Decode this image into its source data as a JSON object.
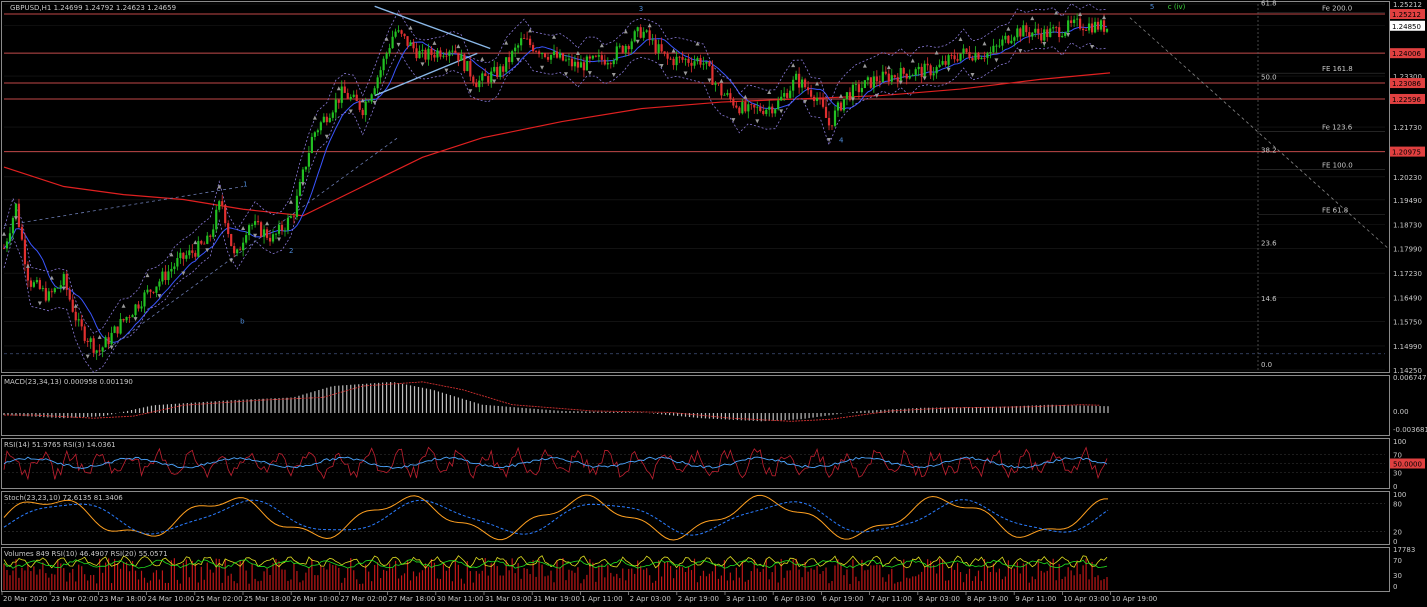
{
  "chart_data": {
    "type": "line",
    "symbol_title": "GBPUSD,H1  1.24699 1.24792 1.24623 1.24659",
    "main": {
      "ylim": [
        1.1425,
        1.2552
      ],
      "y_ticks": [
        1.2552,
        1.2485,
        1.24,
        1.233,
        1.226,
        1.2173,
        1.2097,
        1.202,
        1.1949,
        1.1873,
        1.1799,
        1.1723,
        1.1649,
        1.1575,
        1.1499,
        1.1425
      ],
      "y_tick_labels": [
        "1.25212",
        "1.24850",
        "1.24006",
        "1.23300",
        "1.22596",
        "1.21730",
        "1.20975",
        "1.20230",
        "1.19490",
        "1.18730",
        "1.17990",
        "1.17230",
        "1.16490",
        "1.15750",
        "1.14990",
        "1.14250"
      ],
      "highlight_tags": [
        {
          "text": "1.25212",
          "value": 1.25212,
          "color": "#e04040",
          "fg": "#000000"
        },
        {
          "text": "1.24850",
          "value": 1.2485,
          "color": "#ffffff",
          "fg": "#000000"
        },
        {
          "text": "1.24006",
          "value": 1.24006,
          "color": "#e04040",
          "fg": "#000000"
        },
        {
          "text": "1.23086",
          "value": 1.23086,
          "color": "#e04040",
          "fg": "#000000"
        },
        {
          "text": "1.22596",
          "value": 1.22596,
          "color": "#e04040",
          "fg": "#000000"
        },
        {
          "text": "1.20975",
          "value": 1.20975,
          "color": "#e04040",
          "fg": "#000000"
        }
      ],
      "horizontal_levels": [
        1.25212,
        1.24006,
        1.23086,
        1.22596,
        1.20975
      ],
      "fib_labels": [
        {
          "text": "Fe 200.0",
          "value": 1.2532
        },
        {
          "text": "FE 161.8",
          "value": 1.2345
        },
        {
          "text": "Fe 123.6",
          "value": 1.2165
        },
        {
          "text": "FE 100.0",
          "value": 1.2048
        },
        {
          "text": "FE 61.8",
          "value": 1.191
        }
      ],
      "retrace_labels": [
        {
          "text": "61.8",
          "value": 1.2548
        },
        {
          "text": "50.0",
          "value": 1.232
        },
        {
          "text": "38.2",
          "value": 1.2095
        },
        {
          "text": "23.6",
          "value": 1.1808
        },
        {
          "text": "14.6",
          "value": 1.1638
        },
        {
          "text": "0.0",
          "value": 1.1435
        }
      ],
      "wave_labels": [
        {
          "text": "1",
          "index": 240,
          "value": 1.199
        },
        {
          "text": "b",
          "index": 237,
          "value": 1.1568
        },
        {
          "text": "2",
          "index": 286,
          "value": 1.1785
        },
        {
          "text": "3",
          "index": 637,
          "value": 1.253
        },
        {
          "text": "4",
          "index": 838,
          "value": 1.2125
        },
        {
          "text": "5",
          "index": 1150,
          "value": 1.2537
        },
        {
          "text": "c (iv)",
          "index": 1168,
          "value": 1.2537
        }
      ]
    },
    "x_tick_labels": [
      "20 Mar 2020",
      "23 Mar 02:00",
      "23 Mar 18:00",
      "24 Mar 10:00",
      "25 Mar 02:00",
      "25 Mar 18:00",
      "26 Mar 10:00",
      "27 Mar 02:00",
      "27 Mar 18:00",
      "30 Mar 11:00",
      "31 Mar 03:00",
      "31 Mar 19:00",
      "1 Apr 11:00",
      "2 Apr 03:00",
      "2 Apr 19:00",
      "3 Apr 11:00",
      "6 Apr 03:00",
      "6 Apr 19:00",
      "7 Apr 11:00",
      "8 Apr 03:00",
      "8 Apr 19:00",
      "9 Apr 11:00",
      "10 Apr 03:00",
      "10 Apr 19:00"
    ],
    "panels": {
      "macd": {
        "title": "MACD(23,34,13) 0.000958 0.001190",
        "y_tick_labels": [
          "0.006747",
          "0.00",
          "-0.003681"
        ]
      },
      "rsi": {
        "title": "RSI(14) 51.9765  RSI(3) 14.0361",
        "y_tick_labels": [
          "100",
          "70",
          "50.0000",
          "30",
          "0"
        ],
        "tag": "50.0000"
      },
      "stoch": {
        "title": "Stoch(23,23,10) 72.6135 81.3406",
        "y_tick_labels": [
          "100",
          "80",
          "20",
          "0"
        ]
      },
      "volumes": {
        "title": "Volumes 849  RSI(10) 46.4907  RSI(20) 55.0571",
        "y_tick_labels": [
          "17783",
          "70",
          "30",
          "0"
        ]
      }
    }
  },
  "colors": {
    "background": "#000000",
    "grid": "#1c1c1c",
    "bull_candle": "#22c022",
    "bear_candle": "#e03030",
    "level_line": "#c04848",
    "ma_fast": "#3a55ff",
    "ma_slow": "#e02020",
    "dotted": "#8a7ad8",
    "fractal": "#9a9a9a",
    "trend": "#8ab8e8",
    "macd_hist": "#bdbdbd",
    "macd_signal": "#d03030",
    "rsi_fast": "#c02030",
    "rsi_slow": "#4da6ff",
    "stoch_k": "#ffa020",
    "stoch_d": "#2a7cff",
    "vol_bar": "#c01818",
    "vol_rsi_a": "#e0e020",
    "vol_rsi_b": "#20e020",
    "text": "#c8c8c8"
  }
}
